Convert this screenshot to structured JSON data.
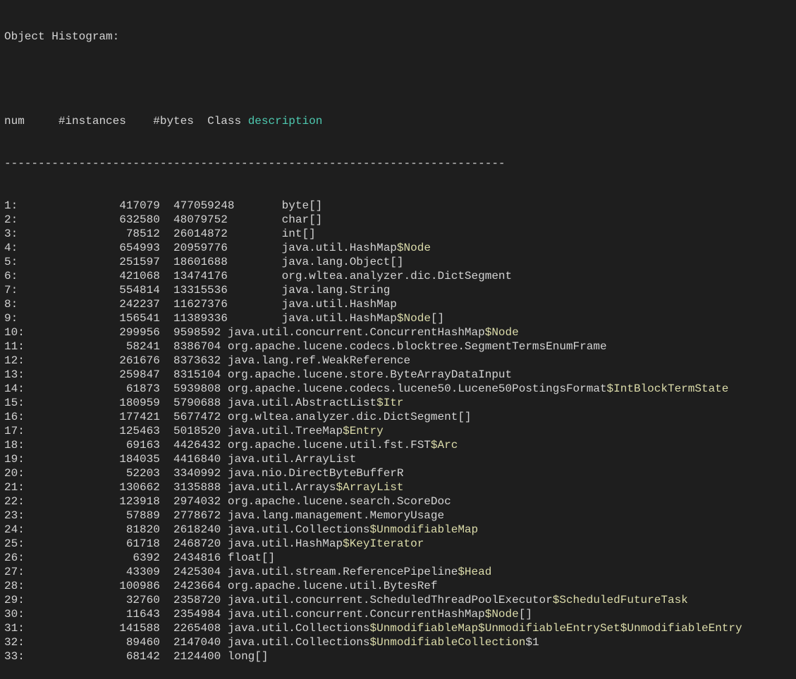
{
  "title": "Object Histogram:",
  "header": {
    "num": "num",
    "instances": "#instances",
    "bytes": "#bytes",
    "class": "Class",
    "description": "description"
  },
  "separator": "--------------------------------------------------------------------------",
  "rows": [
    {
      "num": "1:",
      "instances": "417079",
      "bytes": "477059248",
      "cls": [
        {
          "t": "byte[]"
        }
      ]
    },
    {
      "num": "2:",
      "instances": "632580",
      "bytes": "48079752",
      "cls": [
        {
          "t": "char[]"
        }
      ]
    },
    {
      "num": "3:",
      "instances": "78512",
      "bytes": "26014872",
      "cls": [
        {
          "t": "int[]"
        }
      ]
    },
    {
      "num": "4:",
      "instances": "654993",
      "bytes": "20959776",
      "cls": [
        {
          "t": "java.util.HashMap"
        },
        {
          "t": "$Node",
          "y": true
        }
      ]
    },
    {
      "num": "5:",
      "instances": "251597",
      "bytes": "18601688",
      "cls": [
        {
          "t": "java.lang.Object[]"
        }
      ]
    },
    {
      "num": "6:",
      "instances": "421068",
      "bytes": "13474176",
      "cls": [
        {
          "t": "org.wltea.analyzer.dic.DictSegment"
        }
      ]
    },
    {
      "num": "7:",
      "instances": "554814",
      "bytes": "13315536",
      "cls": [
        {
          "t": "java.lang.String"
        }
      ]
    },
    {
      "num": "8:",
      "instances": "242237",
      "bytes": "11627376",
      "cls": [
        {
          "t": "java.util.HashMap"
        }
      ]
    },
    {
      "num": "9:",
      "instances": "156541",
      "bytes": "11389336",
      "cls": [
        {
          "t": "java.util.HashMap"
        },
        {
          "t": "$Node",
          "y": true
        },
        {
          "t": "[]"
        }
      ]
    },
    {
      "num": "10:",
      "instances": "299956",
      "bytes": "9598592",
      "cls": [
        {
          "t": "java.util.concurrent.ConcurrentHashMap"
        },
        {
          "t": "$Node",
          "y": true
        }
      ],
      "short": true
    },
    {
      "num": "11:",
      "instances": "58241",
      "bytes": "8386704",
      "cls": [
        {
          "t": "org.apache.lucene.codecs.blocktree.SegmentTermsEnumFrame"
        }
      ],
      "short": true
    },
    {
      "num": "12:",
      "instances": "261676",
      "bytes": "8373632",
      "cls": [
        {
          "t": "java.lang.ref.WeakReference"
        }
      ],
      "short": true
    },
    {
      "num": "13:",
      "instances": "259847",
      "bytes": "8315104",
      "cls": [
        {
          "t": "org.apache.lucene.store.ByteArrayDataInput"
        }
      ],
      "short": true
    },
    {
      "num": "14:",
      "instances": "61873",
      "bytes": "5939808",
      "cls": [
        {
          "t": "org.apache.lucene.codecs.lucene50.Lucene50PostingsFormat"
        },
        {
          "t": "$IntBlockTermState",
          "y": true
        }
      ],
      "short": true
    },
    {
      "num": "15:",
      "instances": "180959",
      "bytes": "5790688",
      "cls": [
        {
          "t": "java.util.AbstractList"
        },
        {
          "t": "$Itr",
          "y": true
        }
      ],
      "short": true
    },
    {
      "num": "16:",
      "instances": "177421",
      "bytes": "5677472",
      "cls": [
        {
          "t": "org.wltea.analyzer.dic.DictSegment[]"
        }
      ],
      "short": true
    },
    {
      "num": "17:",
      "instances": "125463",
      "bytes": "5018520",
      "cls": [
        {
          "t": "java.util.TreeMap"
        },
        {
          "t": "$Entry",
          "y": true
        }
      ],
      "short": true
    },
    {
      "num": "18:",
      "instances": "69163",
      "bytes": "4426432",
      "cls": [
        {
          "t": "org.apache.lucene.util.fst.FST"
        },
        {
          "t": "$Arc",
          "y": true
        }
      ],
      "short": true
    },
    {
      "num": "19:",
      "instances": "184035",
      "bytes": "4416840",
      "cls": [
        {
          "t": "java.util.ArrayList"
        }
      ],
      "short": true
    },
    {
      "num": "20:",
      "instances": "52203",
      "bytes": "3340992",
      "cls": [
        {
          "t": "java.nio.DirectByteBufferR"
        }
      ],
      "short": true
    },
    {
      "num": "21:",
      "instances": "130662",
      "bytes": "3135888",
      "cls": [
        {
          "t": "java.util.Arrays"
        },
        {
          "t": "$ArrayList",
          "y": true
        }
      ],
      "short": true
    },
    {
      "num": "22:",
      "instances": "123918",
      "bytes": "2974032",
      "cls": [
        {
          "t": "org.apache.lucene.search.ScoreDoc"
        }
      ],
      "short": true
    },
    {
      "num": "23:",
      "instances": "57889",
      "bytes": "2778672",
      "cls": [
        {
          "t": "java.lang.management.MemoryUsage"
        }
      ],
      "short": true
    },
    {
      "num": "24:",
      "instances": "81820",
      "bytes": "2618240",
      "cls": [
        {
          "t": "java.util.Collections"
        },
        {
          "t": "$UnmodifiableMap",
          "y": true
        }
      ],
      "short": true
    },
    {
      "num": "25:",
      "instances": "61718",
      "bytes": "2468720",
      "cls": [
        {
          "t": "java.util.HashMap"
        },
        {
          "t": "$KeyIterator",
          "y": true
        }
      ],
      "short": true
    },
    {
      "num": "26:",
      "instances": "6392",
      "bytes": "2434816",
      "cls": [
        {
          "t": "float[]"
        }
      ],
      "short": true
    },
    {
      "num": "27:",
      "instances": "43309",
      "bytes": "2425304",
      "cls": [
        {
          "t": "java.util.stream.ReferencePipeline"
        },
        {
          "t": "$Head",
          "y": true
        }
      ],
      "short": true
    },
    {
      "num": "28:",
      "instances": "100986",
      "bytes": "2423664",
      "cls": [
        {
          "t": "org.apache.lucene.util.BytesRef"
        }
      ],
      "short": true
    },
    {
      "num": "29:",
      "instances": "32760",
      "bytes": "2358720",
      "cls": [
        {
          "t": "java.util.concurrent.ScheduledThreadPoolExecutor"
        },
        {
          "t": "$ScheduledFutureTask",
          "y": true
        }
      ],
      "short": true
    },
    {
      "num": "30:",
      "instances": "11643",
      "bytes": "2354984",
      "cls": [
        {
          "t": "java.util.concurrent.ConcurrentHashMap"
        },
        {
          "t": "$Node",
          "y": true
        },
        {
          "t": "[]"
        }
      ],
      "short": true
    },
    {
      "num": "31:",
      "instances": "141588",
      "bytes": "2265408",
      "cls": [
        {
          "t": "java.util.Collections"
        },
        {
          "t": "$UnmodifiableMap",
          "y": true
        },
        {
          "t": "$UnmodifiableEntrySet",
          "y": true
        },
        {
          "t": "$UnmodifiableEntry",
          "y": true
        }
      ],
      "short": true
    },
    {
      "num": "32:",
      "instances": "89460",
      "bytes": "2147040",
      "cls": [
        {
          "t": "java.util.Collections"
        },
        {
          "t": "$UnmodifiableCollection",
          "y": true
        },
        {
          "t": "$1"
        }
      ],
      "short": true
    },
    {
      "num": "33:",
      "instances": "68142",
      "bytes": "2124400",
      "cls": [
        {
          "t": "long[]"
        }
      ],
      "short": true
    }
  ]
}
